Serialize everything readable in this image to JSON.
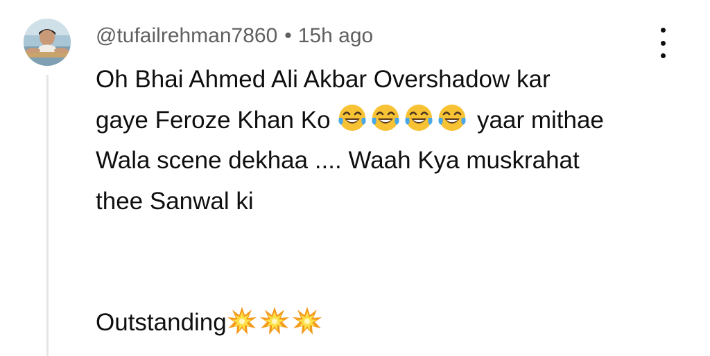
{
  "comment": {
    "username": "@tufailrehman7860",
    "separator": "•",
    "time": "15h ago",
    "lines": [
      "Oh Bhai Ahmed Ali Akbar Overshadow kar",
      "gaye Feroze Khan Ko",
      "yaar mithae",
      "Wala scene dekhaa .... Waah Kya muskrahat",
      "thee Sanwal ki",
      "Outstanding"
    ],
    "emojis": {
      "line2": [
        "face-with-tears-of-joy-icon",
        "face-with-tears-of-joy-icon",
        "face-with-tears-of-joy-icon",
        "face-with-tears-of-joy-icon"
      ],
      "line6": [
        "collision-icon",
        "collision-icon",
        "collision-icon"
      ]
    },
    "colors": {
      "username": "#606060",
      "text": "#0f0f0f",
      "thread_line": "#e5e5e5"
    }
  }
}
